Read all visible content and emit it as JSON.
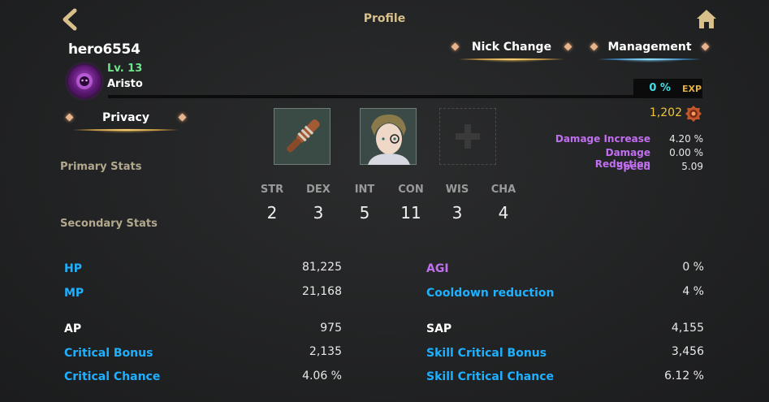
{
  "header": {
    "title": "Profile",
    "back_icon": "back-arrow-icon",
    "home_icon": "home-icon",
    "accent_color": "#d8c08a"
  },
  "player": {
    "nickname": "hero6554",
    "level": "Lv. 13",
    "class": "Aristo",
    "avatar_icon": "lion-emblem-icon"
  },
  "buttons": {
    "nick_change": "Nick Change",
    "management": "Management",
    "privacy": "Privacy"
  },
  "exp": {
    "percent": "0 %",
    "label": "EXP",
    "fill_fraction": 0
  },
  "currency": {
    "amount": "1,202",
    "icon": "gem-coin-icon"
  },
  "equipment": {
    "slots": [
      {
        "icon": "wooden-club-icon",
        "filled": true
      },
      {
        "icon": "character-portrait-icon",
        "filled": true
      },
      {
        "icon": "plus-icon",
        "filled": false
      }
    ]
  },
  "combat_stats": [
    {
      "label": "Damage Increase",
      "value": "4.20 %"
    },
    {
      "label": "Damage Reduction",
      "value": "0.00 %"
    },
    {
      "label": "Speed",
      "value": "5.09"
    }
  ],
  "sections": {
    "primary": "Primary Stats",
    "secondary": "Secondary Stats"
  },
  "abilities": [
    {
      "name": "STR",
      "value": "2"
    },
    {
      "name": "DEX",
      "value": "3"
    },
    {
      "name": "INT",
      "value": "5"
    },
    {
      "name": "CON",
      "value": "11"
    },
    {
      "name": "WIS",
      "value": "3"
    },
    {
      "name": "CHA",
      "value": "4"
    }
  ],
  "secondary_left": [
    {
      "label": "HP",
      "value": "81,225",
      "color": "#1fb0ff"
    },
    {
      "label": "MP",
      "value": "21,168",
      "color": "#1fb0ff"
    },
    {
      "label": "AP",
      "value": "975",
      "color": "#ffffff"
    },
    {
      "label": "Critical Bonus",
      "value": "2,135",
      "color": "#1fb0ff"
    },
    {
      "label": "Critical Chance",
      "value": "4.06 %",
      "color": "#1fb0ff"
    }
  ],
  "secondary_right": [
    {
      "label": "AGI",
      "value": "0 %",
      "color": "#c26ef0"
    },
    {
      "label": "Cooldown reduction",
      "value": "4 %",
      "color": "#1fb0ff"
    },
    {
      "label": "SAP",
      "value": "4,155",
      "color": "#ffffff"
    },
    {
      "label": "Skill Critical Bonus",
      "value": "3,456",
      "color": "#1fb0ff"
    },
    {
      "label": "Skill Critical Chance",
      "value": "6.12 %",
      "color": "#1fb0ff"
    }
  ]
}
